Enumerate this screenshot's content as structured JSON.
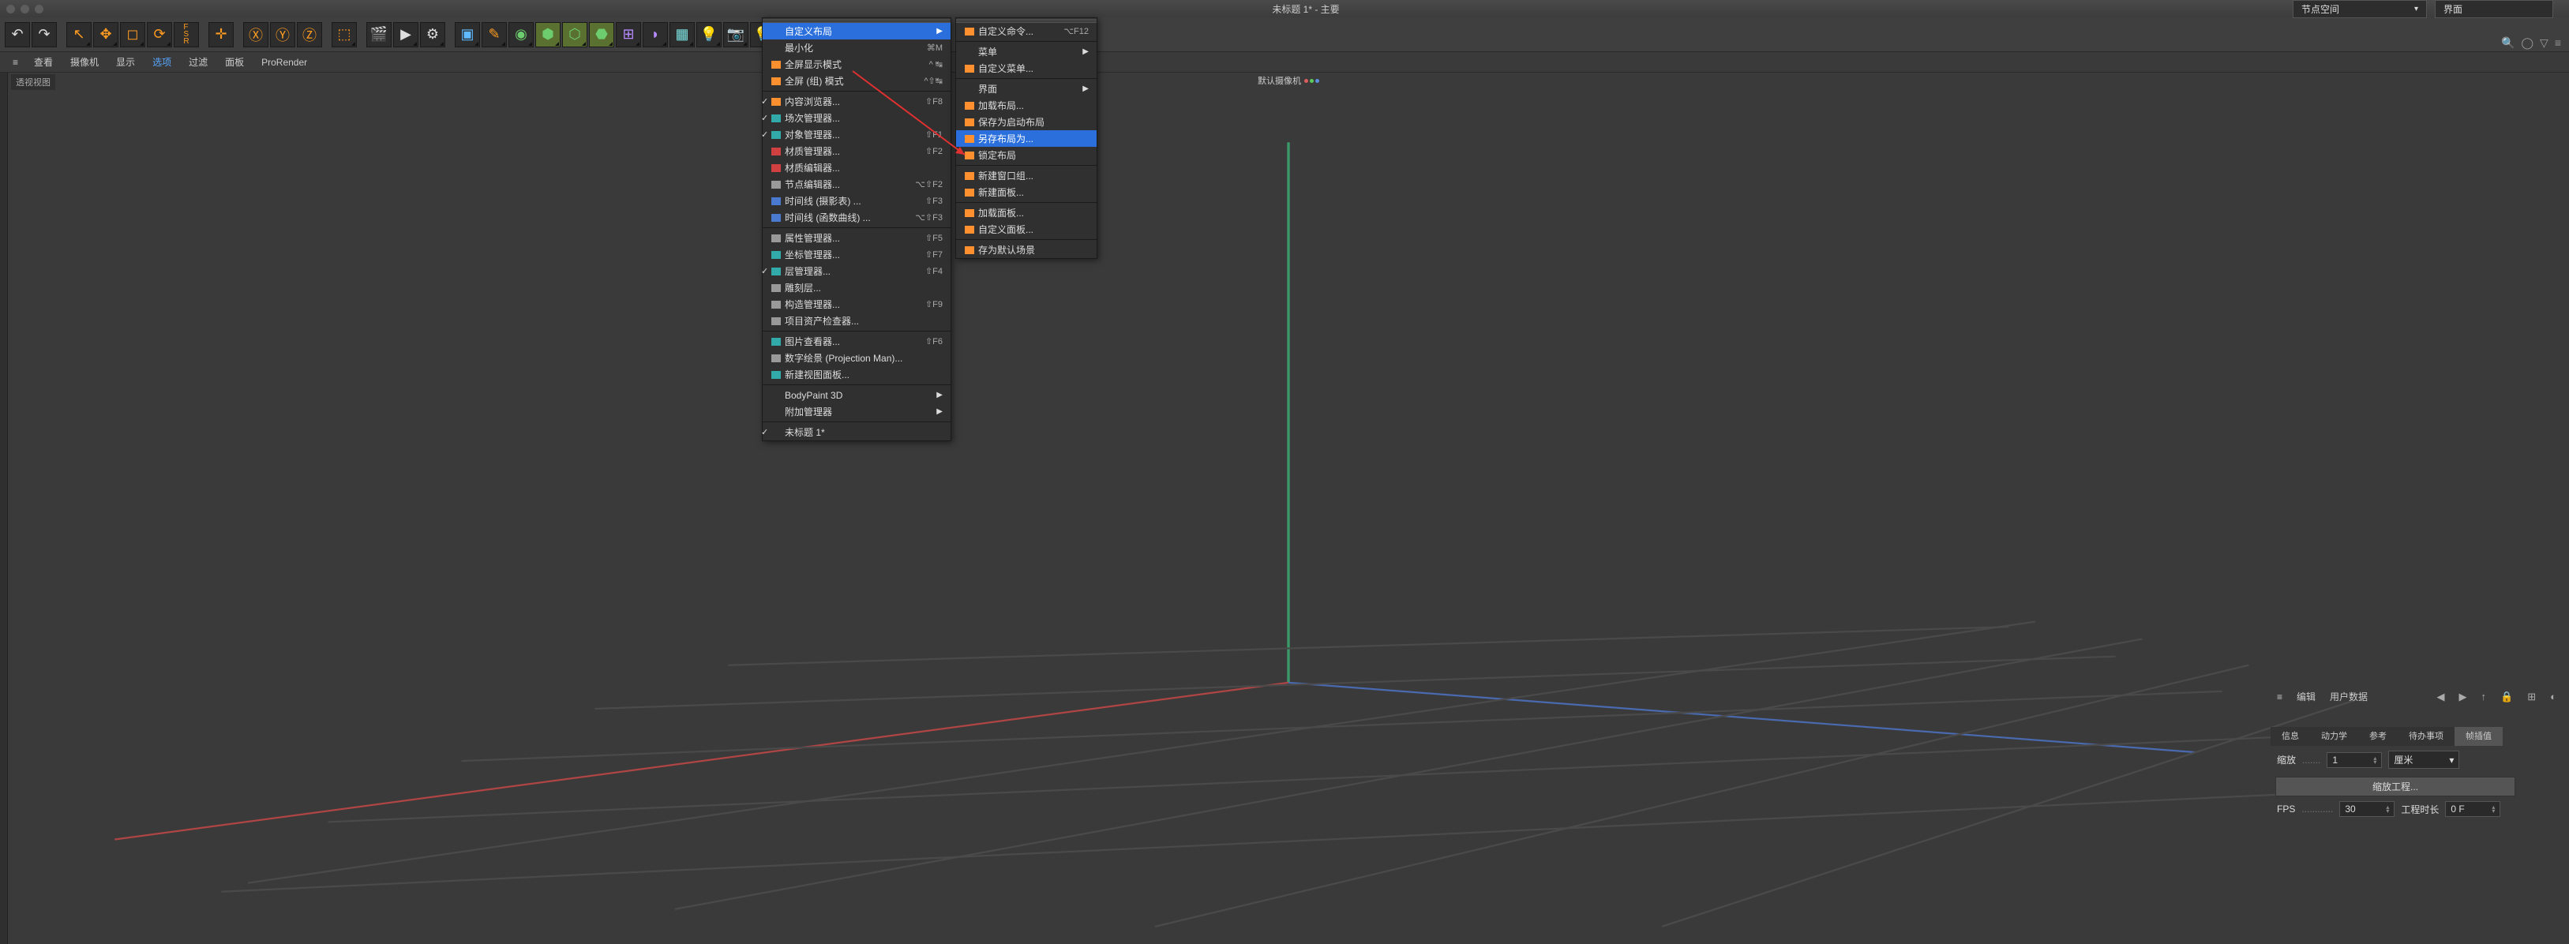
{
  "window": {
    "title": "未标题 1* - 主要"
  },
  "dropdowns": {
    "left": "节点空间",
    "right": "界面"
  },
  "menubar": {
    "items": [
      "查看",
      "摄像机",
      "显示",
      "选项",
      "过滤",
      "面板",
      "ProRender"
    ],
    "selected_index": 3
  },
  "viewport": {
    "corner_label": "透视视图",
    "camera_label": "默认摄像机"
  },
  "menu1": {
    "items": [
      {
        "label": "自定义布局",
        "sub": true,
        "hl": true
      },
      {
        "label": "最小化",
        "shortcut": "⌘M"
      },
      {
        "label": "全屏显示模式",
        "shortcut": "^ ↹",
        "icon": "orange"
      },
      {
        "label": "全屏 (组) 模式",
        "shortcut": "^⇧↹",
        "icon": "orange"
      },
      {
        "sep": true
      },
      {
        "label": "内容浏览器...",
        "shortcut": "⇧F8",
        "icon": "orange",
        "check": true
      },
      {
        "label": "场次管理器...",
        "icon": "teal",
        "check": true
      },
      {
        "label": "对象管理器...",
        "shortcut": "⇧F1",
        "icon": "teal",
        "check": true
      },
      {
        "label": "材质管理器...",
        "shortcut": "⇧F2",
        "icon": "red"
      },
      {
        "label": "材质编辑器...",
        "icon": "red"
      },
      {
        "label": "节点编辑器...",
        "shortcut": "⌥⇧F2",
        "icon": "grey"
      },
      {
        "label": "时间线  (摄影表) ...",
        "shortcut": "⇧F3",
        "icon": "blue"
      },
      {
        "label": "时间线  (函数曲线) ...",
        "shortcut": "⌥⇧F3",
        "icon": "blue"
      },
      {
        "sep": true
      },
      {
        "label": "属性管理器...",
        "shortcut": "⇧F5",
        "icon": "grey"
      },
      {
        "label": "坐标管理器...",
        "shortcut": "⇧F7",
        "icon": "teal"
      },
      {
        "label": "层管理器...",
        "shortcut": "⇧F4",
        "icon": "teal",
        "check": true
      },
      {
        "label": "雕刻层...",
        "icon": "grey"
      },
      {
        "label": "构造管理器...",
        "shortcut": "⇧F9",
        "icon": "grey"
      },
      {
        "label": "项目资产检查器...",
        "icon": "grey"
      },
      {
        "sep": true
      },
      {
        "label": "图片查看器...",
        "shortcut": "⇧F6",
        "icon": "teal"
      },
      {
        "label": "数字绘景 (Projection Man)...",
        "icon": "grey"
      },
      {
        "label": "新建视图面板...",
        "icon": "teal"
      },
      {
        "sep": true
      },
      {
        "label": "BodyPaint 3D",
        "sub": true
      },
      {
        "label": "附加管理器",
        "sub": true
      },
      {
        "sep": true
      },
      {
        "label": "未标题 1*",
        "check": true
      }
    ]
  },
  "menu2": {
    "items": [
      {
        "label": "自定义命令...",
        "shortcut": "⌥F12",
        "icon": "orange"
      },
      {
        "sep": true
      },
      {
        "label": "菜单",
        "sub": true
      },
      {
        "label": "自定义菜单...",
        "icon": "orange"
      },
      {
        "sep": true
      },
      {
        "label": "界面",
        "sub": true
      },
      {
        "label": "加载布局...",
        "icon": "orange"
      },
      {
        "label": "保存为启动布局",
        "icon": "orange"
      },
      {
        "label": "另存布局为...",
        "icon": "orange",
        "hl": true
      },
      {
        "label": "锁定布局",
        "icon": "orange"
      },
      {
        "sep": true
      },
      {
        "label": "新建窗口组...",
        "icon": "orange"
      },
      {
        "label": "新建面板...",
        "icon": "orange"
      },
      {
        "sep": true
      },
      {
        "label": "加载面板...",
        "icon": "orange"
      },
      {
        "label": "自定义面板...",
        "icon": "orange"
      },
      {
        "sep": true
      },
      {
        "label": "存为默认场景",
        "icon": "orange"
      }
    ]
  },
  "attributes": {
    "mode": "编辑",
    "userdata": "用户数据",
    "tabs": [
      "信息",
      "动力学",
      "参考",
      "待办事项",
      "帧插值"
    ],
    "active_tab": 4,
    "scale_label": "缩放",
    "scale_value": "1",
    "unit": "厘米",
    "scale_project": "缩放工程...",
    "fps_label": "FPS",
    "fps_value": "30",
    "duration_label": "工程时长",
    "duration_value": "0 F"
  }
}
